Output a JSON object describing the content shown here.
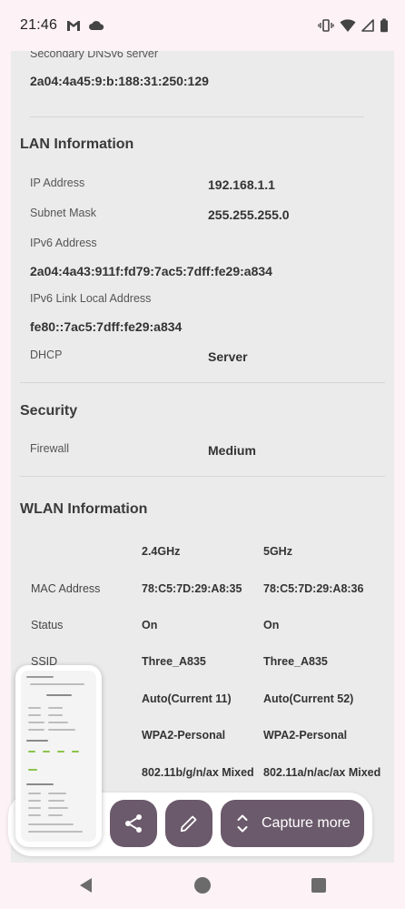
{
  "status_bar": {
    "time": "21:46",
    "left_icons": [
      "gmail-icon",
      "cloud-icon"
    ],
    "right_icons": [
      "vibrate-icon",
      "wifi-icon",
      "signal-icon",
      "battery-icon"
    ]
  },
  "dns": {
    "label": "Secondary DNSv6 server",
    "value": "2a04:4a45:9:b:188:31:250:129"
  },
  "lan": {
    "title": "LAN Information",
    "ip_label": "IP Address",
    "ip_value": "192.168.1.1",
    "subnet_label": "Subnet Mask",
    "subnet_value": "255.255.255.0",
    "ipv6_label": "IPv6 Address",
    "ipv6_value": "2a04:4a43:911f:fd79:7ac5:7dff:fe29:a834",
    "ipv6_link_label": "IPv6 Link Local Address",
    "ipv6_link_value": "fe80::7ac5:7dff:fe29:a834",
    "dhcp_label": "DHCP",
    "dhcp_value": "Server"
  },
  "security": {
    "title": "Security",
    "firewall_label": "Firewall",
    "firewall_value": "Medium"
  },
  "wlan": {
    "title": "WLAN Information",
    "band_24": "2.4GHz",
    "band_5": "5GHz",
    "rows": [
      {
        "label": "MAC Address",
        "v24": "78:C5:7D:29:A8:35",
        "v5": "78:C5:7D:29:A8:36"
      },
      {
        "label": "Status",
        "v24": "On",
        "v5": "On"
      },
      {
        "label": "SSID",
        "v24": "Three_A835",
        "v5": "Three_A835"
      },
      {
        "label": "",
        "v24": "Auto(Current 11)",
        "v5": "Auto(Current 52)"
      },
      {
        "label": "",
        "v24": "WPA2-Personal",
        "v5": "WPA2-Personal"
      },
      {
        "label": "",
        "v24": "802.11b/g/n/ax Mixed",
        "v5": "802.11a/n/ac/ax Mixed"
      }
    ]
  },
  "actions": {
    "share_icon": "share-icon",
    "edit_icon": "pencil-icon",
    "capture_more_label": "Capture more"
  },
  "navigation": {
    "back": "back-icon",
    "home": "home-icon",
    "recents": "recents-icon"
  }
}
